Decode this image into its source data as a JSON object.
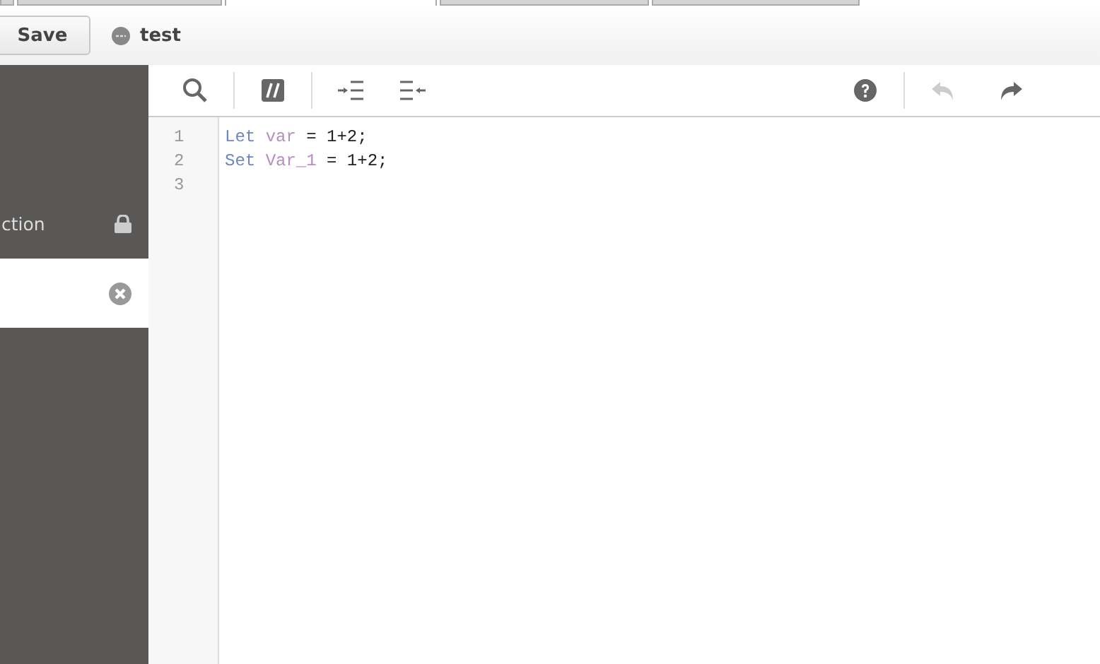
{
  "tabs": [
    {
      "selected": false
    },
    {
      "selected": false
    },
    {
      "selected": true
    },
    {
      "selected": false
    },
    {
      "selected": false
    }
  ],
  "header": {
    "save_button": "Save",
    "status": {
      "label": "test"
    }
  },
  "sidebar": {
    "items": [
      {
        "label": "ction",
        "kind": "locked",
        "selected": false
      },
      {
        "kind": "removable",
        "selected": true
      }
    ]
  },
  "toolbar": {
    "buttons": [
      {
        "kind": "search",
        "disabled": false
      },
      {
        "kind": "comment",
        "disabled": false
      },
      {
        "kind": "indent",
        "disabled": false
      },
      {
        "kind": "outdent",
        "disabled": false
      },
      {
        "kind": "help",
        "disabled": false
      },
      {
        "kind": "undo",
        "disabled": true
      },
      {
        "kind": "redo",
        "disabled": false
      }
    ]
  },
  "editor": {
    "lines": [
      {
        "number": "1",
        "tokens": [
          {
            "kind": "keyword",
            "text": "Let "
          },
          {
            "kind": "variable",
            "text": "var"
          },
          {
            "kind": "plain",
            "text": " = 1+2;"
          }
        ]
      },
      {
        "number": "2",
        "tokens": [
          {
            "kind": "keyword",
            "text": "Set "
          },
          {
            "kind": "variable",
            "text": "Var_1"
          },
          {
            "kind": "plain",
            "text": " = 1+2;"
          }
        ]
      },
      {
        "number": "3"
      }
    ]
  }
}
